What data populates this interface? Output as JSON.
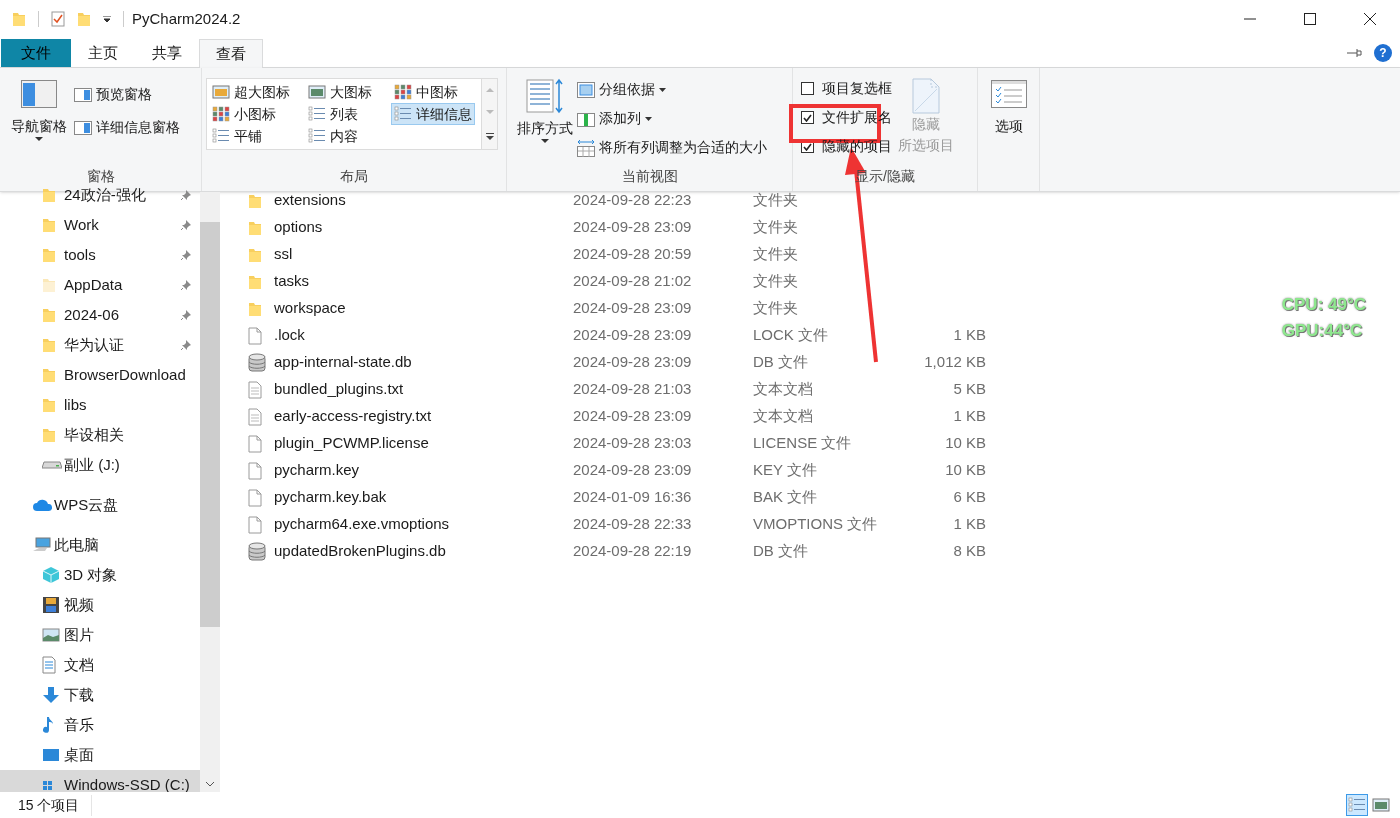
{
  "window": {
    "title": "PyCharm2024.2"
  },
  "tabs": [
    {
      "label": "文件",
      "kind": "file",
      "selected": false
    },
    {
      "label": "主页",
      "kind": "tab",
      "selected": false
    },
    {
      "label": "共享",
      "kind": "tab",
      "selected": false
    },
    {
      "label": "查看",
      "kind": "tab",
      "selected": true
    }
  ],
  "help_button": "?",
  "ribbon": {
    "panes": {
      "label": "窗格",
      "nav_pane": "导航窗格",
      "preview_pane": "预览窗格",
      "details_pane": "详细信息窗格"
    },
    "layout": {
      "label": "布局",
      "options": [
        {
          "label": "超大图标",
          "selected": false
        },
        {
          "label": "大图标",
          "selected": false
        },
        {
          "label": "中图标",
          "selected": false
        },
        {
          "label": "小图标",
          "selected": false
        },
        {
          "label": "列表",
          "selected": false
        },
        {
          "label": "详细信息",
          "selected": true
        },
        {
          "label": "平铺",
          "selected": false
        },
        {
          "label": "内容",
          "selected": false
        }
      ]
    },
    "current_view": {
      "label": "当前视图",
      "sort_by": "排序方式",
      "group_by": "分组依据",
      "add_columns": "添加列",
      "fit_columns": "将所有列调整为合适的大小"
    },
    "show_hide": {
      "label": "显示/隐藏",
      "checkboxes": [
        {
          "label": "项目复选框",
          "checked": false
        },
        {
          "label": "文件扩展名",
          "checked": true
        },
        {
          "label": "隐藏的项目",
          "checked": true
        }
      ],
      "hide_selected": {
        "line1": "隐藏",
        "line2": "所选项目",
        "disabled": true
      }
    },
    "options": {
      "label": "选项"
    }
  },
  "sidebar": {
    "items": [
      {
        "label": "24政治-强化",
        "kind": "folder",
        "pinned": true,
        "selected": false
      },
      {
        "label": "Work",
        "kind": "folder",
        "pinned": true,
        "selected": false
      },
      {
        "label": "tools",
        "kind": "folder",
        "pinned": true,
        "selected": false
      },
      {
        "label": "AppData",
        "kind": "hidden",
        "pinned": true,
        "selected": false
      },
      {
        "label": "2024-06",
        "kind": "folder",
        "pinned": true,
        "selected": false
      },
      {
        "label": "华为认证",
        "kind": "folder",
        "pinned": true,
        "selected": false
      },
      {
        "label": "BrowserDownload",
        "kind": "folder",
        "pinned": false,
        "selected": false
      },
      {
        "label": "libs",
        "kind": "folder",
        "pinned": false,
        "selected": false
      },
      {
        "label": "毕设相关",
        "kind": "folder",
        "pinned": false,
        "selected": false
      },
      {
        "label": "副业 (J:)",
        "kind": "drive",
        "pinned": false,
        "selected": false
      },
      {
        "label": "WPS云盘",
        "kind": "cloud",
        "pinned": false,
        "selected": false
      },
      {
        "label": "此电脑",
        "kind": "computer",
        "pinned": false,
        "selected": false
      },
      {
        "label": "3D 对象",
        "kind": "objects",
        "pinned": false,
        "selected": false
      },
      {
        "label": "视频",
        "kind": "videos",
        "pinned": false,
        "selected": false
      },
      {
        "label": "图片",
        "kind": "pictures",
        "pinned": false,
        "selected": false
      },
      {
        "label": "文档",
        "kind": "documents",
        "pinned": false,
        "selected": false
      },
      {
        "label": "下载",
        "kind": "downloads",
        "pinned": false,
        "selected": false
      },
      {
        "label": "音乐",
        "kind": "music",
        "pinned": false,
        "selected": false
      },
      {
        "label": "桌面",
        "kind": "desktop",
        "pinned": false,
        "selected": false
      },
      {
        "label": "Windows-SSD (C:)",
        "kind": "system",
        "pinned": false,
        "selected": true
      }
    ]
  },
  "files": [
    {
      "name": "extensions",
      "date": "2024-09-28 22:23",
      "type": "文件夹",
      "kind": "folder"
    },
    {
      "name": "options",
      "date": "2024-09-28 23:09",
      "type": "文件夹",
      "kind": "folder"
    },
    {
      "name": "ssl",
      "date": "2024-09-28 20:59",
      "type": "文件夹",
      "kind": "folder"
    },
    {
      "name": "tasks",
      "date": "2024-09-28 21:02",
      "type": "文件夹",
      "kind": "folder"
    },
    {
      "name": "workspace",
      "date": "2024-09-28 23:09",
      "type": "文件夹",
      "kind": "folder"
    },
    {
      "name": ".lock",
      "date": "2024-09-28 23:09",
      "type": "LOCK 文件",
      "size": "1 KB",
      "kind": "file"
    },
    {
      "name": "app-internal-state.db",
      "date": "2024-09-28 23:09",
      "type": "DB 文件",
      "size": "1,012 KB",
      "kind": "database"
    },
    {
      "name": "bundled_plugins.txt",
      "date": "2024-09-28 21:03",
      "type": "文本文档",
      "size": "5 KB",
      "kind": "text"
    },
    {
      "name": "early-access-registry.txt",
      "date": "2024-09-28 23:09",
      "type": "文本文档",
      "size": "1 KB",
      "kind": "text"
    },
    {
      "name": "plugin_PCWMP.license",
      "date": "2024-09-28 23:03",
      "type": "LICENSE 文件",
      "size": "10 KB",
      "kind": "file"
    },
    {
      "name": "pycharm.key",
      "date": "2024-09-28 23:09",
      "type": "KEY 文件",
      "size": "10 KB",
      "kind": "file"
    },
    {
      "name": "pycharm.key.bak",
      "date": "2024-01-09 16:36",
      "type": "BAK 文件",
      "size": "6 KB",
      "kind": "file"
    },
    {
      "name": "pycharm64.exe.vmoptions",
      "date": "2024-09-28 22:33",
      "type": "VMOPTIONS 文件",
      "size": "1 KB",
      "kind": "file"
    },
    {
      "name": "updatedBrokenPlugins.db",
      "date": "2024-09-28 22:19",
      "type": "DB 文件",
      "size": "8 KB",
      "kind": "database"
    }
  ],
  "temperature_overlay": [
    "CPU: 49°C",
    "GPU:44°C"
  ],
  "status_bar": {
    "count": "15 个项目",
    "views": [
      {
        "kind": "details",
        "selected": true
      },
      {
        "kind": "large",
        "selected": false
      }
    ]
  }
}
